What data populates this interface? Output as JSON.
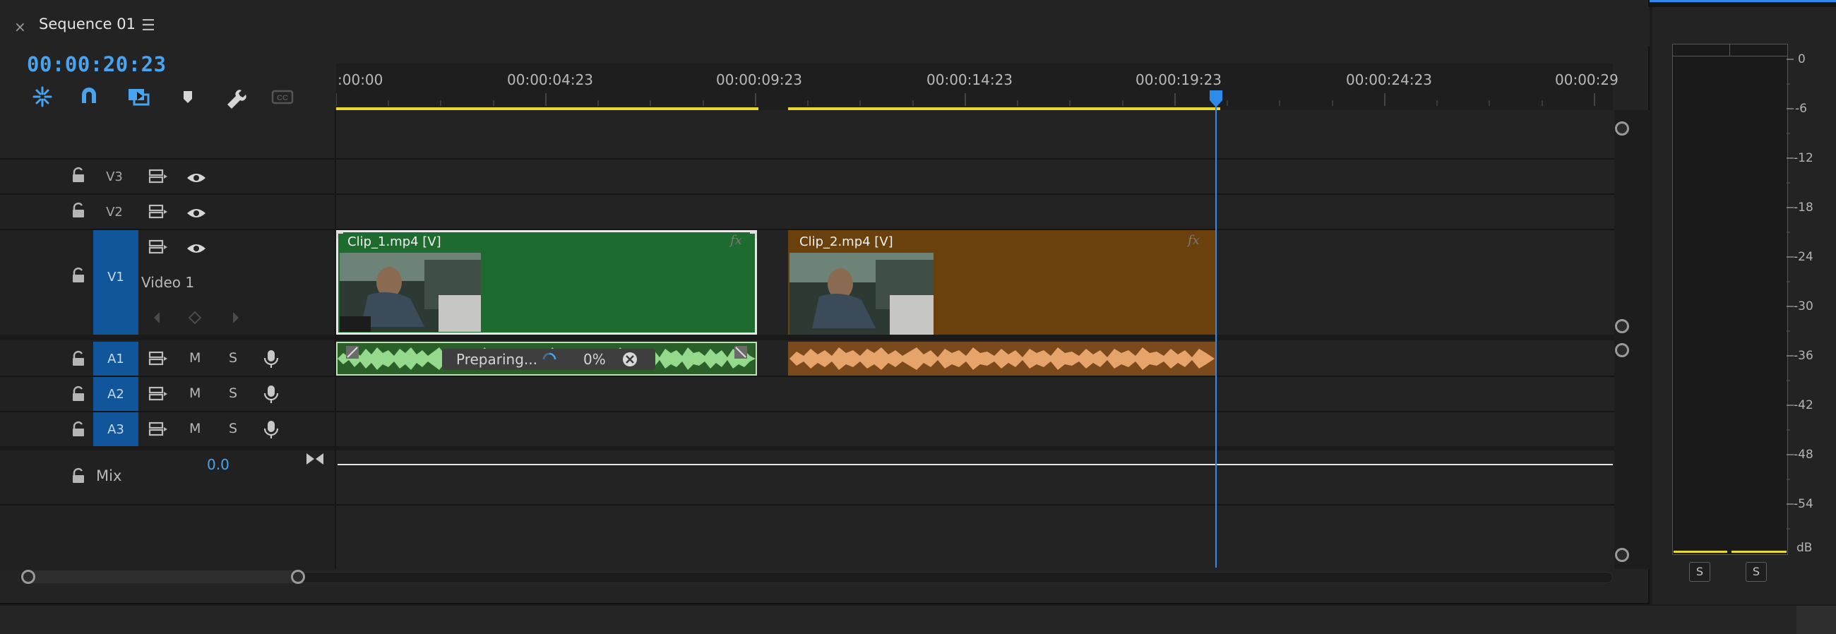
{
  "panel": {
    "tab_title": "Sequence 01",
    "close_glyph": "×",
    "menu_glyph": "☰"
  },
  "timecode": "00:00:20:23",
  "toolbar": {
    "icons": [
      "snap-insert-icon",
      "magnet-icon",
      "linked-selection-icon",
      "marker-icon",
      "wrench-icon",
      "captions-icon"
    ],
    "captions_label": "CC"
  },
  "ruler": {
    "labels": [
      ":00:00",
      "00:00:04:23",
      "00:00:09:23",
      "00:00:14:23",
      "00:00:19:23",
      "00:00:24:23",
      "00:00:29"
    ],
    "playhead_timecode": "00:00:20:23"
  },
  "tracks": {
    "v3": {
      "name": "V3"
    },
    "v2": {
      "name": "V2"
    },
    "v1": {
      "name": "V1",
      "label": "Video 1"
    },
    "a1": {
      "name": "A1",
      "mute": "M",
      "solo": "S"
    },
    "a2": {
      "name": "A2",
      "mute": "M",
      "solo": "S"
    },
    "a3": {
      "name": "A3",
      "mute": "M",
      "solo": "S"
    },
    "mix": {
      "name": "Mix",
      "value": "0.0"
    }
  },
  "clips": {
    "clip1": {
      "label": "Clip_1.mp4 [V]",
      "fx": "fx",
      "color": "#1e6b30",
      "audio_color": "#95d98c"
    },
    "clip2": {
      "label": "Clip_2.mp4 [V]",
      "fx": "fx",
      "color": "#6a400c",
      "audio_color": "#e7a46a"
    }
  },
  "render_status": {
    "text": "Preparing...",
    "percent": "0%",
    "progress": 0
  },
  "meter": {
    "scale": [
      "0",
      "-6",
      "-12",
      "-18",
      "-24",
      "-30",
      "-36",
      "-42",
      "-48",
      "-54",
      "dB"
    ],
    "solo_left": "S",
    "solo_right": "S"
  },
  "colors": {
    "accent": "#2d8ceb",
    "timecode": "#4aa3ef",
    "work_area": "#e8d92a",
    "target_track": "#11569a"
  }
}
